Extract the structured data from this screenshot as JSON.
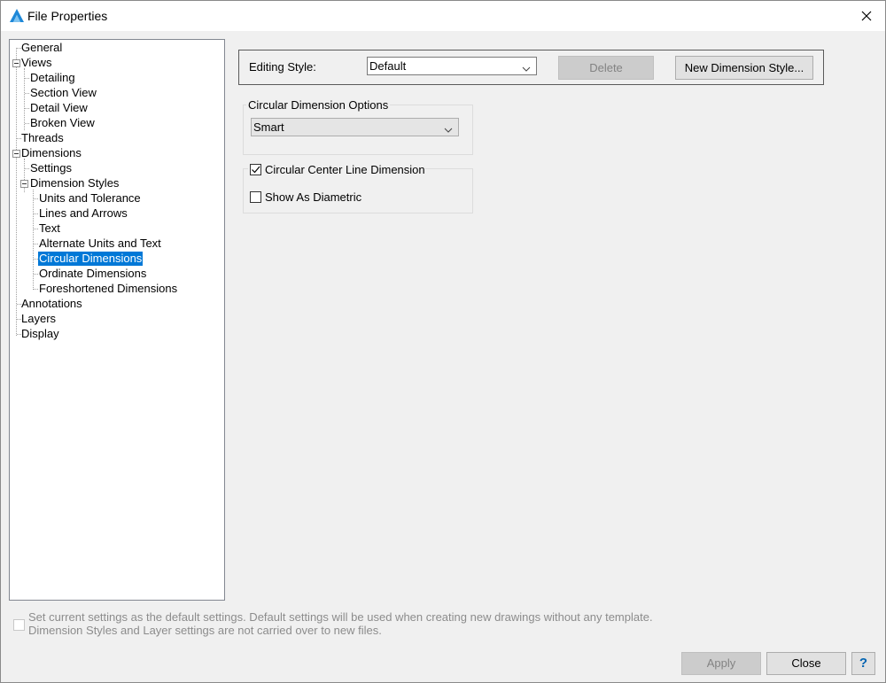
{
  "window": {
    "title": "File Properties"
  },
  "tree": {
    "items": [
      {
        "label": "General"
      },
      {
        "label": "Views"
      },
      {
        "label": "Detailing"
      },
      {
        "label": "Section View"
      },
      {
        "label": "Detail View"
      },
      {
        "label": "Broken View"
      },
      {
        "label": "Threads"
      },
      {
        "label": "Dimensions"
      },
      {
        "label": "Settings"
      },
      {
        "label": "Dimension Styles"
      },
      {
        "label": "Units and Tolerance"
      },
      {
        "label": "Lines and Arrows"
      },
      {
        "label": "Text"
      },
      {
        "label": "Alternate Units and Text"
      },
      {
        "label": "Circular Dimensions"
      },
      {
        "label": "Ordinate Dimensions"
      },
      {
        "label": "Foreshortened Dimensions"
      },
      {
        "label": "Annotations"
      },
      {
        "label": "Layers"
      },
      {
        "label": "Display"
      }
    ],
    "selected": "Circular Dimensions"
  },
  "editing_style": {
    "label": "Editing Style:",
    "value": "Default",
    "delete_label": "Delete",
    "new_label": "New Dimension Style..."
  },
  "circular_options": {
    "group_label": "Circular Dimension Options",
    "value": "Smart"
  },
  "center_line": {
    "label": "Circular Center Line Dimension",
    "checked": true,
    "show_diametric_label": "Show As Diametric",
    "show_diametric_checked": false
  },
  "footer": {
    "default_line1": "Set current settings as the default settings. Default settings will be used when creating new drawings without any template.",
    "default_line2": "Dimension Styles and Layer settings are not carried over to new files.",
    "apply_label": "Apply",
    "close_label": "Close",
    "help_label": "?"
  }
}
